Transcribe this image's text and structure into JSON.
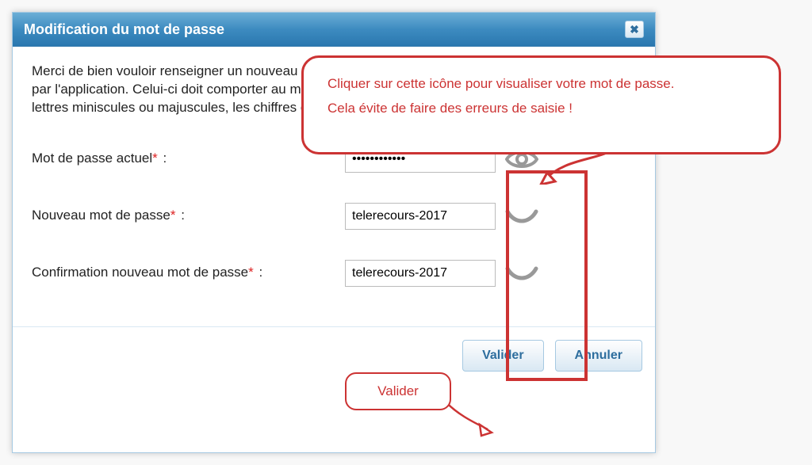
{
  "dialog": {
    "title": "Modification du mot de passe",
    "instructions": "Merci de bien vouloir renseigner un nouveau mot de passe différent de celui qui vous a été donné par l'application. Celui-ci doit comporter au minimum 12 caractères. Les caractères autorisés sont les lettres miniscules ou majuscules, les chiffres et les caractères spéciaux suivants : _ééà=*{}[]ç"
  },
  "fields": {
    "current": {
      "label": "Mot de passe actuel",
      "value": "••••••••••••"
    },
    "new": {
      "label": "Nouveau mot de passe",
      "value": "telerecours-2017"
    },
    "confirm": {
      "label": "Confirmation nouveau mot de passe",
      "value": "telerecours-2017"
    }
  },
  "buttons": {
    "validate": "Valider",
    "cancel": "Annuler"
  },
  "annotations": {
    "eye_tip_line1": "Cliquer sur cette icône pour visualiser votre mot de passe.",
    "eye_tip_line2": "Cela évite de faire des erreurs de saisie !",
    "validate_tip": "Valider"
  }
}
